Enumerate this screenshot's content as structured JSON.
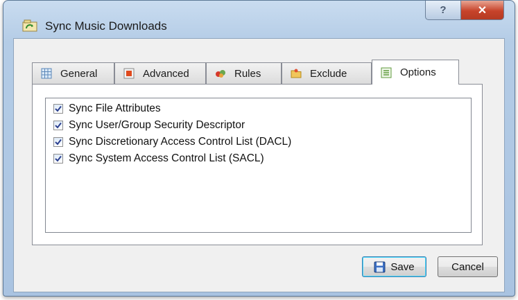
{
  "window": {
    "title": "Sync Music Downloads",
    "help_label": "?",
    "close_label": "✕"
  },
  "tabs": [
    {
      "label": "General",
      "icon": "general-grid-icon"
    },
    {
      "label": "Advanced",
      "icon": "advanced-icon"
    },
    {
      "label": "Rules",
      "icon": "rules-icon"
    },
    {
      "label": "Exclude",
      "icon": "exclude-folder-icon"
    },
    {
      "label": "Options",
      "icon": "options-list-icon",
      "active": true
    }
  ],
  "options": [
    {
      "label": "Sync File Attributes",
      "checked": true
    },
    {
      "label": "Sync User/Group Security Descriptor",
      "checked": true
    },
    {
      "label": "Sync Discretionary Access Control List (DACL)",
      "checked": true
    },
    {
      "label": "Sync System Access Control List (SACL)",
      "checked": true
    }
  ],
  "buttons": {
    "save_label": "Save",
    "cancel_label": "Cancel"
  },
  "colors": {
    "titlebar": "#b4cce6",
    "close_button": "#c7432a",
    "client_bg": "#f0f0f0"
  }
}
